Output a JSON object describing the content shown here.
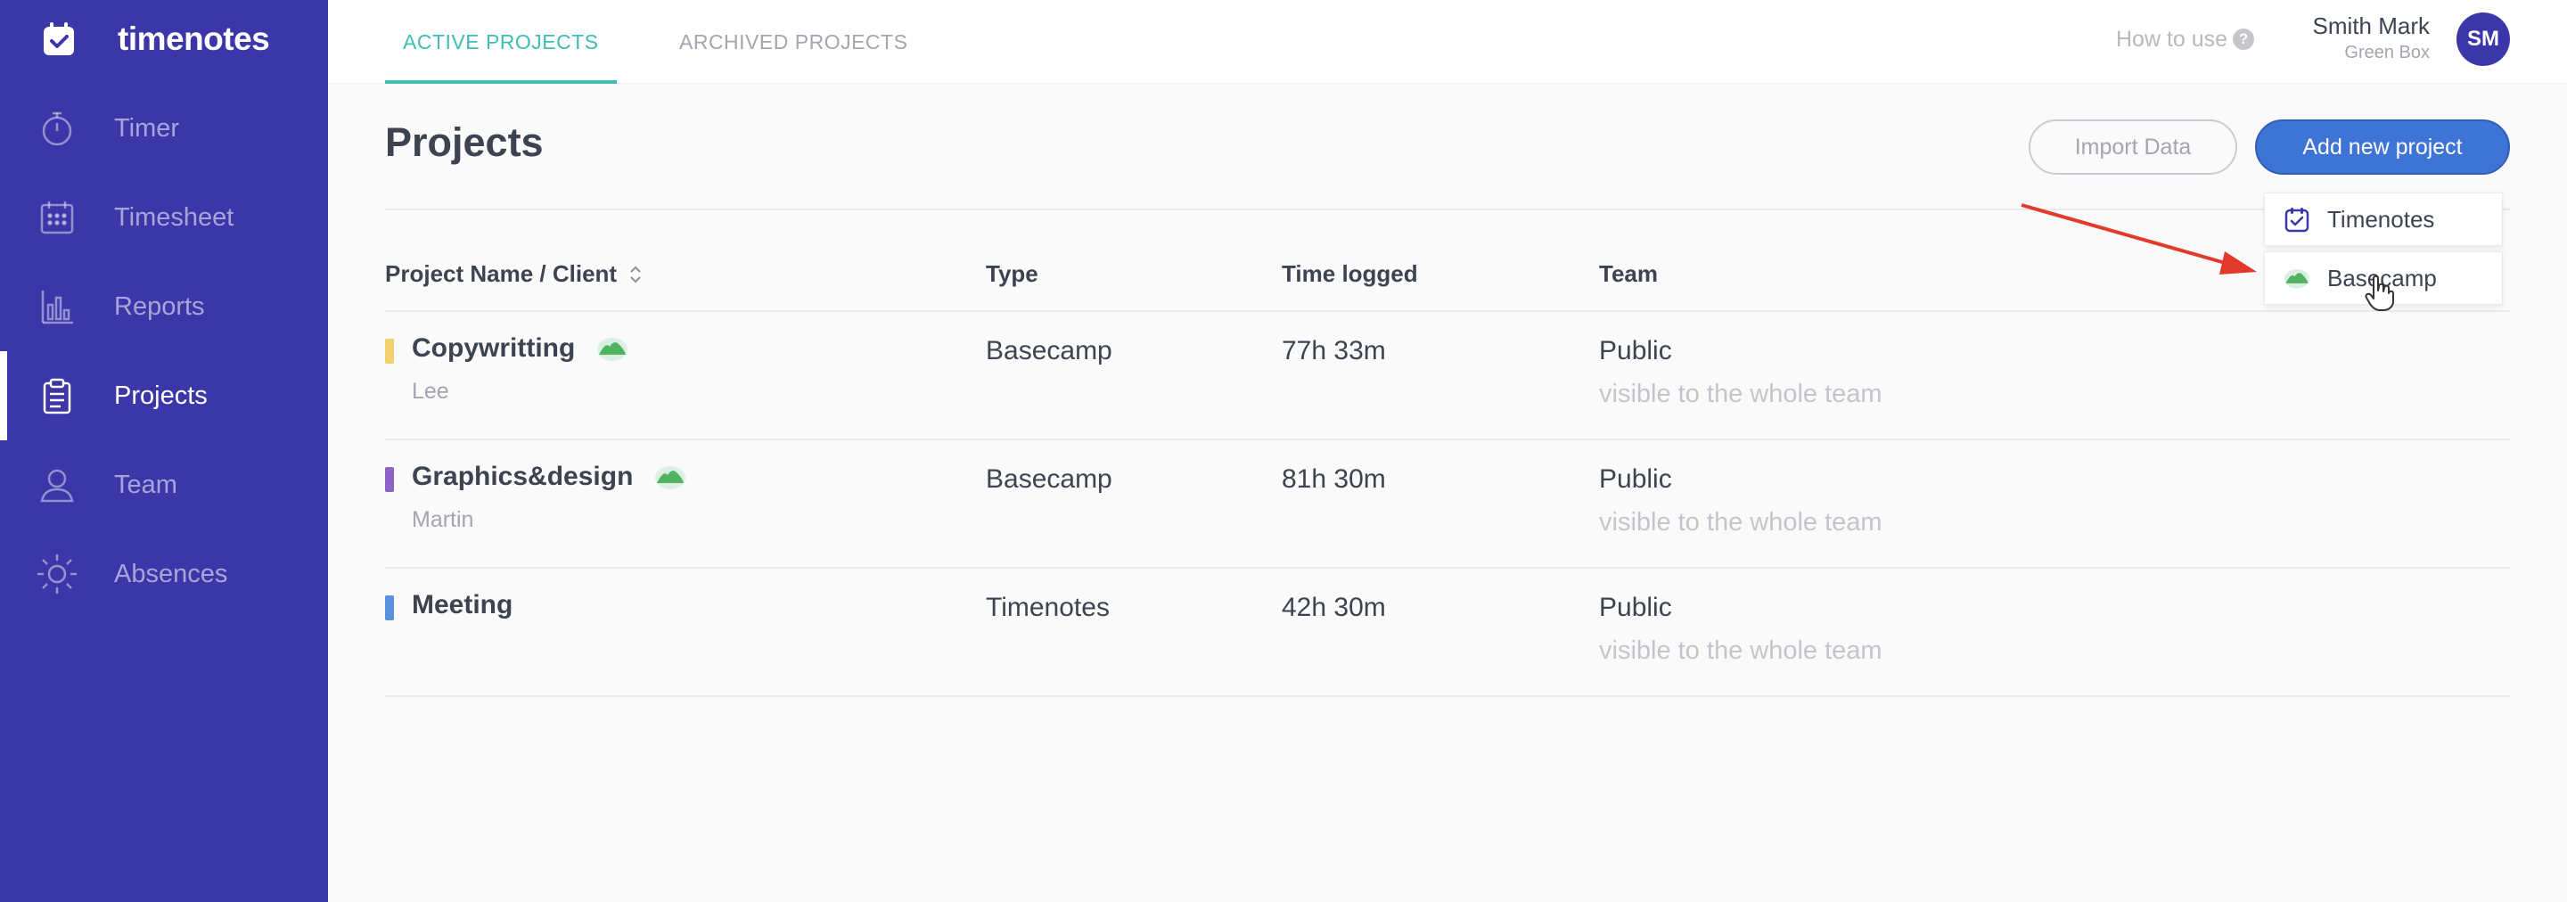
{
  "brand": {
    "name": "timenotes"
  },
  "sidebar": {
    "items": [
      {
        "label": "Timer",
        "icon": "stopwatch-icon"
      },
      {
        "label": "Timesheet",
        "icon": "calendar-grid-icon"
      },
      {
        "label": "Reports",
        "icon": "bar-chart-icon"
      },
      {
        "label": "Projects",
        "icon": "clipboard-icon",
        "active": true
      },
      {
        "label": "Team",
        "icon": "person-icon"
      },
      {
        "label": "Absences",
        "icon": "sun-icon"
      }
    ]
  },
  "topbar": {
    "tabs": [
      {
        "label": "ACTIVE PROJECTS",
        "active": true
      },
      {
        "label": "ARCHIVED PROJECTS",
        "active": false
      }
    ],
    "how_to_use": "How to use",
    "help_symbol": "?",
    "user": {
      "name": "Smith Mark",
      "org": "Green Box",
      "initials": "SM"
    }
  },
  "main": {
    "title": "Projects",
    "import_button": "Import Data",
    "add_button": "Add new project",
    "dropdown": [
      {
        "label": "Timenotes",
        "icon": "timenotes-icon"
      },
      {
        "label": "Basecamp",
        "icon": "basecamp-icon"
      }
    ],
    "columns": [
      "Project Name / Client",
      "Type",
      "Time logged",
      "Team"
    ],
    "rows": [
      {
        "name": "Copywritting",
        "client": "Lee",
        "type": "Basecamp",
        "time": "77h 33m",
        "team": "Public",
        "team_note": "visible to the whole team",
        "color": "#f2d06b",
        "basecamp": true
      },
      {
        "name": "Graphics&design",
        "client": "Martin",
        "type": "Basecamp",
        "time": "81h 30m",
        "team": "Public",
        "team_note": "visible to the whole team",
        "color": "#8e63c7",
        "basecamp": true
      },
      {
        "name": "Meeting",
        "client": "",
        "type": "Timenotes",
        "time": "42h 30m",
        "team": "Public",
        "team_note": "visible to the whole team",
        "color": "#5b8fe0",
        "basecamp": false
      }
    ]
  },
  "colors": {
    "sidebar": "#3b37a8",
    "accent_teal": "#3fbdb4",
    "primary_blue": "#3e74d6",
    "annotation_arrow": "#e33b2b"
  }
}
